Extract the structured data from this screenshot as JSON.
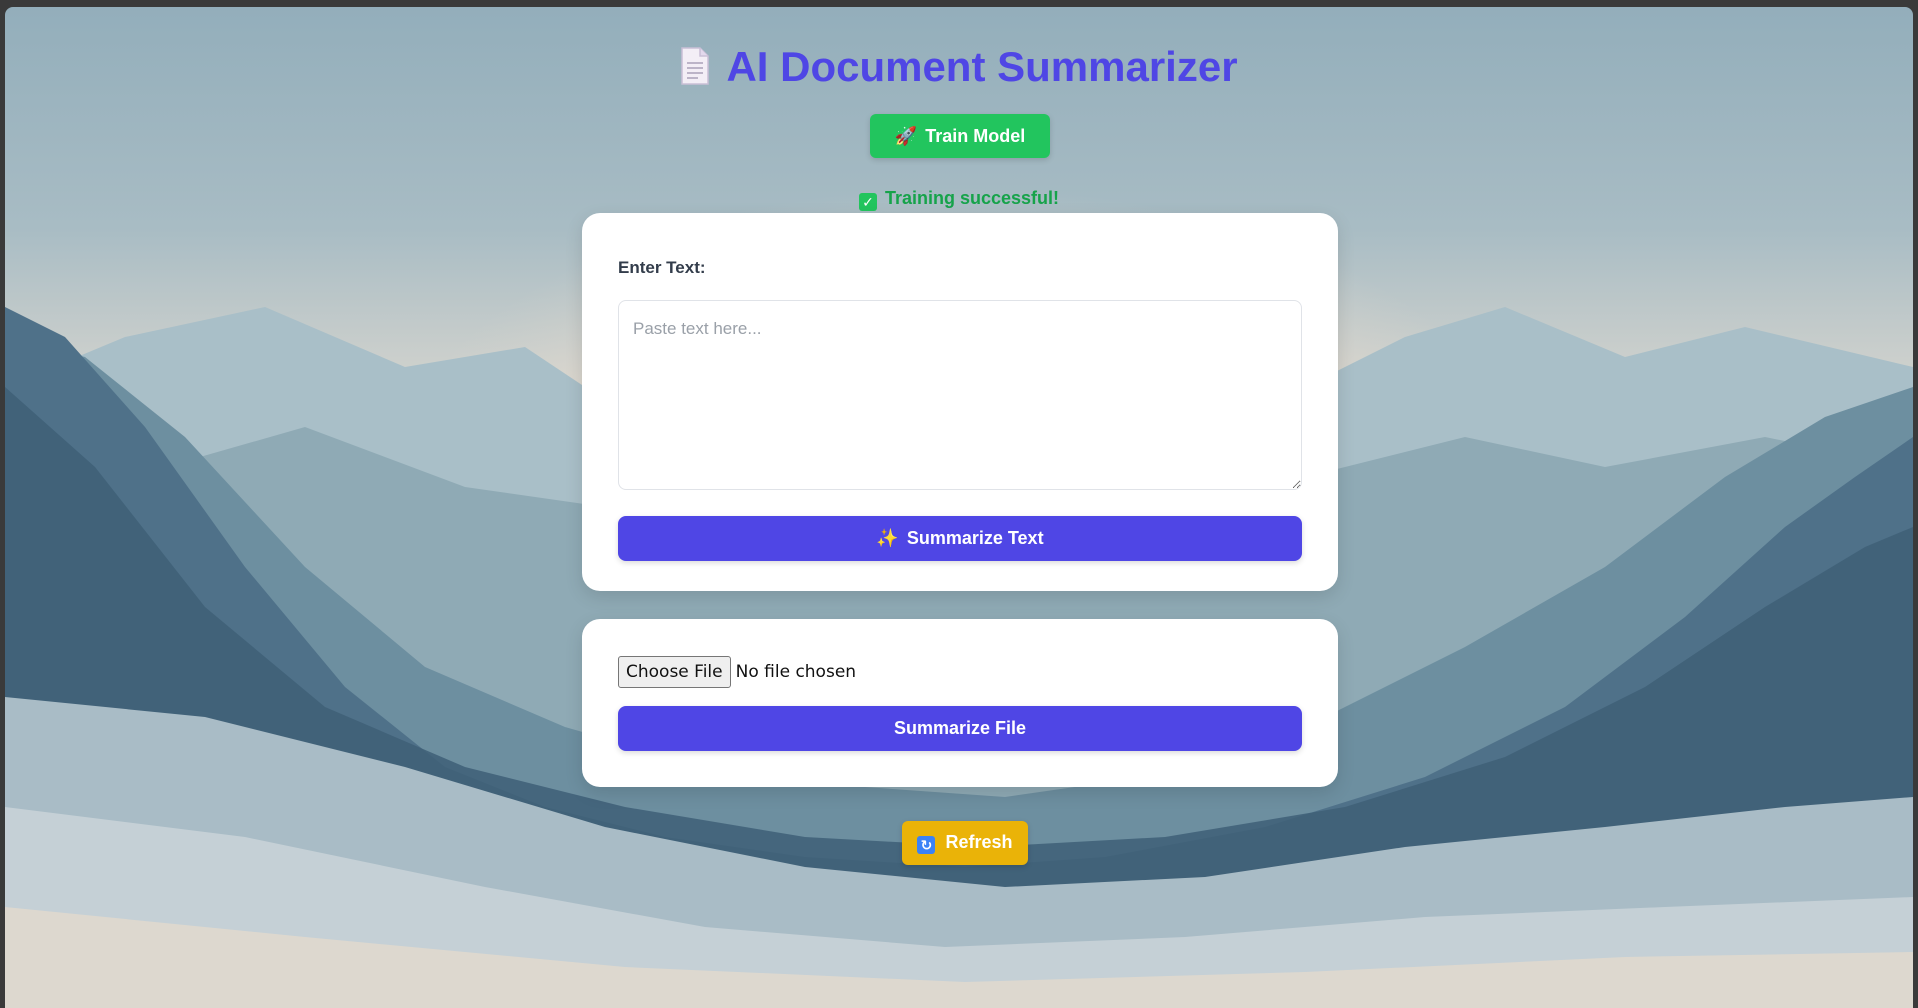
{
  "app": {
    "title": "AI Document Summarizer",
    "title_icon": "document-icon"
  },
  "train": {
    "label": "Train Model",
    "icon": "rocket-icon",
    "status_text": "Training successful!",
    "status_icon": "check-icon"
  },
  "text_card": {
    "label": "Enter Text:",
    "placeholder": "Paste text here...",
    "value": "",
    "button_label": "Summarize Text",
    "button_icon": "sparkles-icon"
  },
  "file_card": {
    "choose_label": "Choose File",
    "file_status": "No file chosen",
    "button_label": "Summarize File"
  },
  "refresh": {
    "label": "Refresh",
    "icon": "refresh-icon"
  },
  "colors": {
    "title": "#4f46e5",
    "train_button": "#22c55e",
    "status": "#16a34a",
    "primary_button": "#4f46e5",
    "refresh_button": "#eab308"
  }
}
